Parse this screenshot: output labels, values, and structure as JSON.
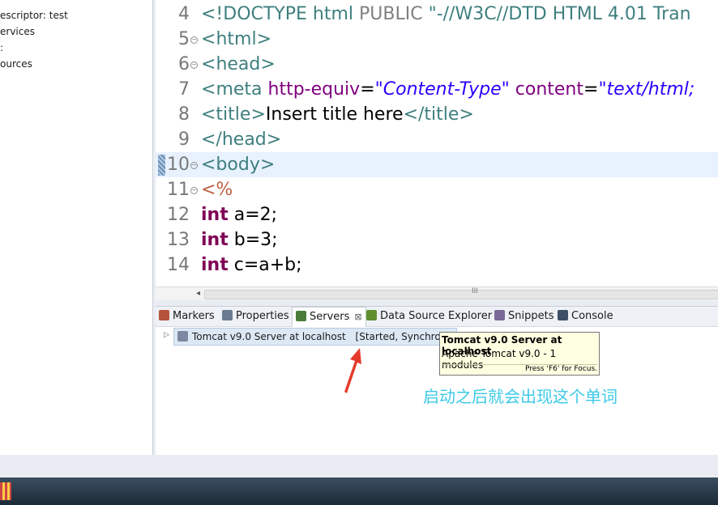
{
  "left_tree": [
    "escriptor: test",
    "ervices",
    ":",
    "ources"
  ],
  "editor": {
    "lines": [
      {
        "num": "4",
        "fold": false,
        "tokens": [
          {
            "t": "<!DOCTYPE html ",
            "c": "#3f7f7f"
          },
          {
            "t": "PUBLIC ",
            "c": "#808080"
          },
          {
            "t": "\"-//W3C//DTD HTML 4.01 Tran",
            "c": "#3f7f7f"
          }
        ]
      },
      {
        "num": "5",
        "fold": true,
        "tokens": [
          {
            "t": "<",
            "c": "#3f7f7f"
          },
          {
            "t": "html",
            "c": "#3f7f7f"
          },
          {
            "t": ">",
            "c": "#3f7f7f"
          }
        ]
      },
      {
        "num": "6",
        "fold": true,
        "tokens": [
          {
            "t": "<",
            "c": "#3f7f7f"
          },
          {
            "t": "head",
            "c": "#3f7f7f"
          },
          {
            "t": ">",
            "c": "#3f7f7f"
          }
        ]
      },
      {
        "num": "7",
        "fold": false,
        "tokens": [
          {
            "t": "<",
            "c": "#3f7f7f"
          },
          {
            "t": "meta ",
            "c": "#3f7f7f"
          },
          {
            "t": "http-equiv",
            "c": "#7f007f"
          },
          {
            "t": "=",
            "c": "#000000"
          },
          {
            "t": "\"Content-Type\"",
            "c": "#2a00ff",
            "i": true
          },
          {
            "t": " content",
            "c": "#7f007f"
          },
          {
            "t": "=",
            "c": "#000000"
          },
          {
            "t": "\"text/html;",
            "c": "#2a00ff",
            "i": true
          }
        ]
      },
      {
        "num": "8",
        "fold": false,
        "tokens": [
          {
            "t": "<title>",
            "c": "#3f7f7f"
          },
          {
            "t": "Insert title here",
            "c": "#000000"
          },
          {
            "t": "</title>",
            "c": "#3f7f7f"
          }
        ]
      },
      {
        "num": "9",
        "fold": false,
        "tokens": [
          {
            "t": "</head>",
            "c": "#3f7f7f"
          }
        ]
      },
      {
        "num": "10",
        "fold": true,
        "current": true,
        "tokens": [
          {
            "t": "<body>",
            "c": "#3f7f7f"
          }
        ]
      },
      {
        "num": "11",
        "fold": true,
        "tokens": [
          {
            "t": "<%",
            "c": "#bf5f3f"
          }
        ]
      },
      {
        "num": "12",
        "fold": false,
        "tokens": [
          {
            "t": "int",
            "c": "#7f0055",
            "b": true
          },
          {
            "t": " a=2;",
            "c": "#000000"
          }
        ]
      },
      {
        "num": "13",
        "fold": false,
        "tokens": [
          {
            "t": "int",
            "c": "#7f0055",
            "b": true
          },
          {
            "t": " b=3;",
            "c": "#000000"
          }
        ]
      },
      {
        "num": "14",
        "fold": false,
        "tokens": [
          {
            "t": "int",
            "c": "#7f0055",
            "b": true
          },
          {
            "t": " c=a+b;",
            "c": "#000000"
          }
        ]
      }
    ],
    "scroll_grip": "III"
  },
  "bottom_panel": {
    "tabs": [
      {
        "label": "Markers",
        "icon": "markers-icon",
        "color": "#b5543c"
      },
      {
        "label": "Properties",
        "icon": "properties-icon",
        "color": "#6b7b8f"
      },
      {
        "label": "Servers",
        "icon": "servers-icon",
        "color": "#4a7d3a",
        "active": true
      },
      {
        "label": "Data Source Explorer",
        "icon": "data-source-icon",
        "color": "#5f8f2f"
      },
      {
        "label": "Snippets",
        "icon": "snippets-icon",
        "color": "#7a6a9a"
      },
      {
        "label": "Console",
        "icon": "console-icon",
        "color": "#3d4f66"
      }
    ],
    "close_glyph": "⊠",
    "server": {
      "name": "Tomcat v9.0 Server at localhost",
      "status": "[Started, Synchroniz"
    }
  },
  "tooltip": {
    "title": "Tomcat v9.0 Server at localhost",
    "body": "Apache Tomcat v9.0 - 1 modules",
    "hint": "Press 'F6' for Focus."
  },
  "annotation": "启动之后就会出现这个单词"
}
